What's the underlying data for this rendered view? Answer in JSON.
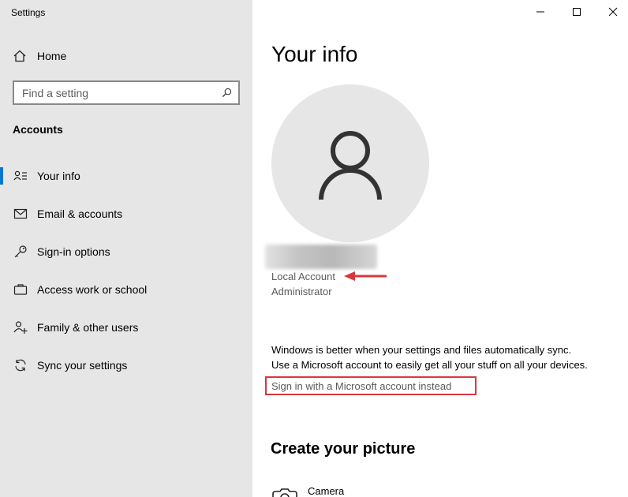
{
  "window": {
    "title": "Settings"
  },
  "sidebar": {
    "home_label": "Home",
    "search_placeholder": "Find a setting",
    "section_heading": "Accounts",
    "items": [
      {
        "label": "Your info",
        "icon": "contact-info-icon",
        "selected": true
      },
      {
        "label": "Email & accounts",
        "icon": "mail-icon",
        "selected": false
      },
      {
        "label": "Sign-in options",
        "icon": "key-icon",
        "selected": false
      },
      {
        "label": "Access work or school",
        "icon": "briefcase-icon",
        "selected": false
      },
      {
        "label": "Family & other users",
        "icon": "add-user-icon",
        "selected": false
      },
      {
        "label": "Sync your settings",
        "icon": "sync-icon",
        "selected": false
      }
    ]
  },
  "main": {
    "title": "Your info",
    "account_type": "Local Account",
    "account_role": "Administrator",
    "sync_message_line1": "Windows is better when your settings and files automatically sync.",
    "sync_message_line2": "Use a Microsoft account to easily get all your stuff on all your devices.",
    "signin_link": "Sign in with a Microsoft account instead",
    "picture_heading": "Create your picture",
    "camera_label": "Camera"
  },
  "colors": {
    "accent": "#0078d7",
    "highlight": "#d9373f",
    "sidebar_bg": "#e6e6e6"
  }
}
